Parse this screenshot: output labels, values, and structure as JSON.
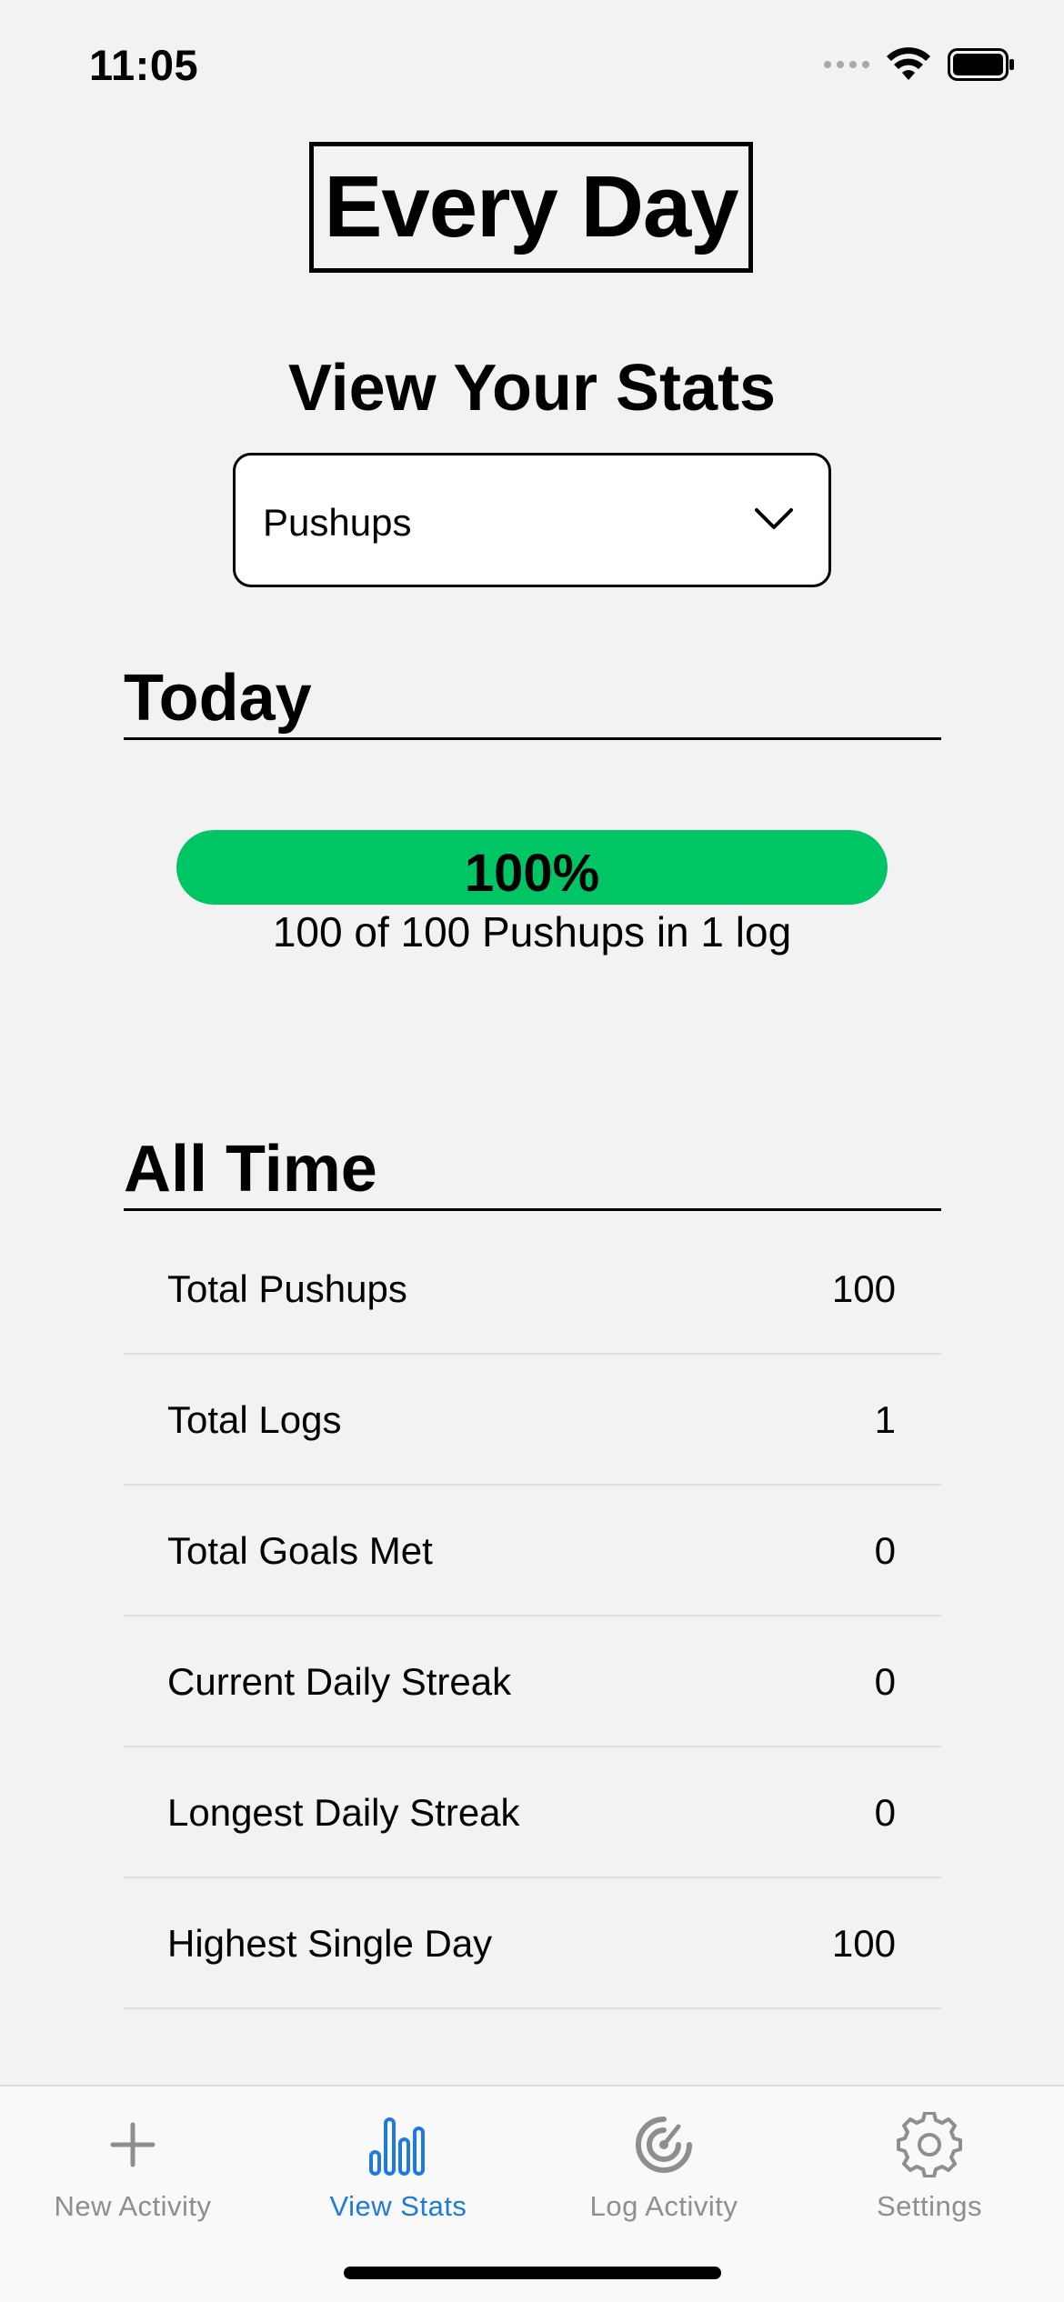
{
  "status_bar": {
    "time": "11:05"
  },
  "header": {
    "app_title": "Every Day",
    "page_heading": "View Your Stats"
  },
  "activity_select": {
    "value": "Pushups"
  },
  "today": {
    "heading": "Today",
    "progress_fraction": 1.0,
    "progress_percent_label": "100%",
    "caption": "100 of 100 Pushups in 1 log",
    "fill_color": "#00c565"
  },
  "all_time": {
    "heading": "All Time",
    "rows": [
      {
        "label": "Total Pushups",
        "value": "100"
      },
      {
        "label": "Total Logs",
        "value": "1"
      },
      {
        "label": "Total Goals Met",
        "value": "0"
      },
      {
        "label": "Current Daily Streak",
        "value": "0"
      },
      {
        "label": "Longest Daily Streak",
        "value": "0"
      },
      {
        "label": "Highest Single Day",
        "value": "100"
      }
    ]
  },
  "tab_bar": {
    "active_color": "#1f7ae0",
    "inactive_color": "#8e8e8e",
    "tabs": [
      {
        "label": "New Activity",
        "icon": "plus-icon"
      },
      {
        "label": "View Stats",
        "icon": "bar-chart-icon",
        "active": true
      },
      {
        "label": "Log Activity",
        "icon": "target-icon"
      },
      {
        "label": "Settings",
        "icon": "gear-icon"
      }
    ]
  }
}
